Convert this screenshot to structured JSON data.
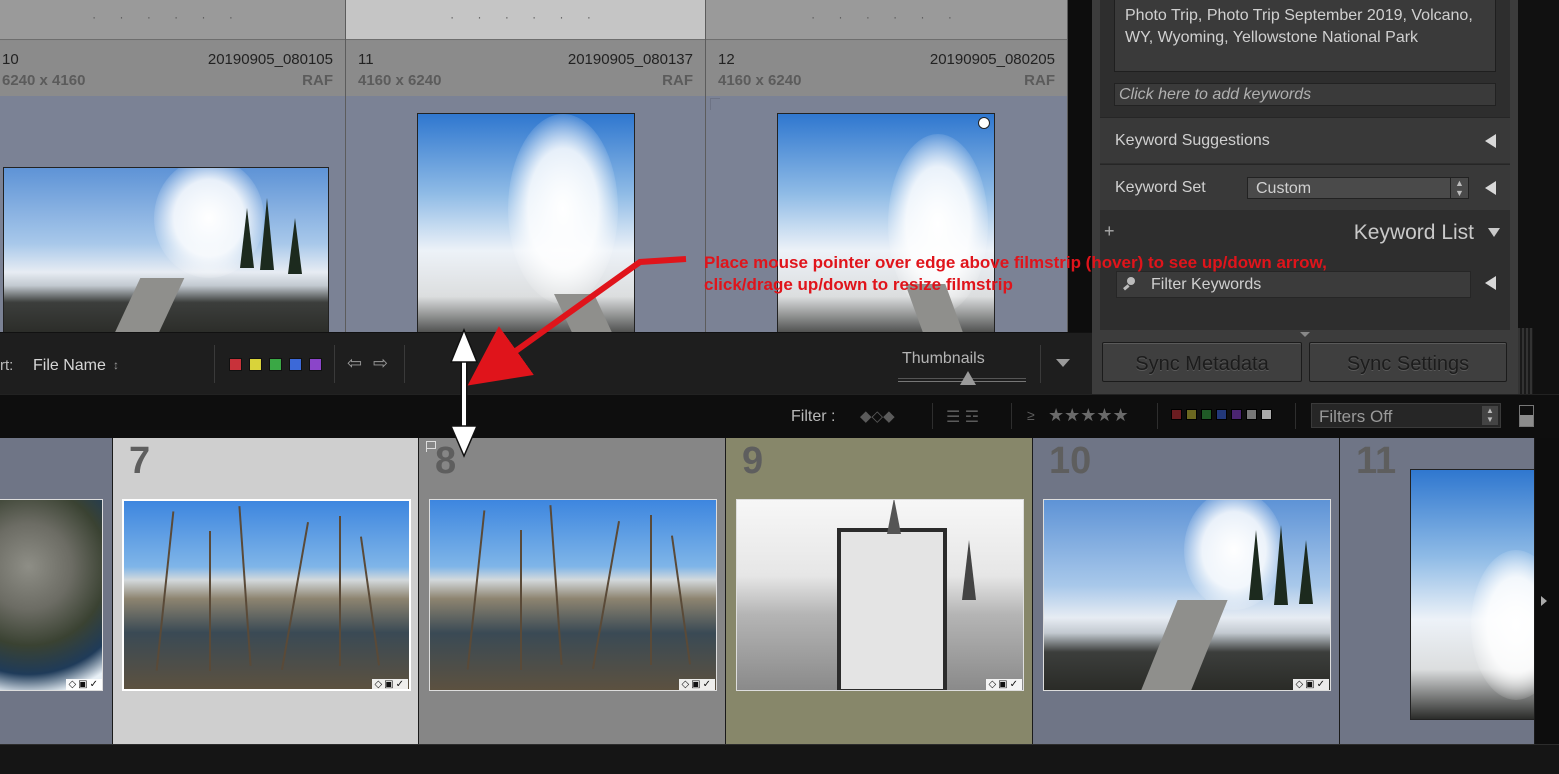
{
  "grid": {
    "cells": [
      {
        "num": "10",
        "filename": "20190905_080105",
        "dims": "6240 x 4160",
        "type": "RAF"
      },
      {
        "num": "11",
        "filename": "20190905_080137",
        "dims": "4160 x 6240",
        "type": "RAF"
      },
      {
        "num": "12",
        "filename": "20190905_080205",
        "dims": "4160 x 6240",
        "type": "RAF"
      }
    ]
  },
  "toolbar": {
    "sort_label": "rt:",
    "sort_value": "File Name",
    "sort_caret": "↕",
    "color_labels": [
      "#c8323a",
      "#d9d33a",
      "#3aa845",
      "#3c69d8",
      "#8b45c9"
    ],
    "prev_icon": "⇦",
    "next_icon": "⇨",
    "thumbnails_label": "Thumbnails",
    "thumbnails_level": 0.55
  },
  "right_panel": {
    "keywords_text": "Photo Trip, Photo Trip September 2019, Volcano, WY, Wyoming, Yellowstone National Park",
    "add_keywords_placeholder": "Click here to add keywords",
    "keyword_suggestions": "Keyword Suggestions",
    "keyword_set_label": "Keyword Set",
    "keyword_set_value": "Custom",
    "keyword_list_plus": "+",
    "keyword_list_title": "Keyword List",
    "filter_keywords": "Filter Keywords",
    "sync_metadata": "Sync Metadata",
    "sync_settings": "Sync Settings"
  },
  "filter_bar": {
    "label": "Filter :",
    "flag_icons": "◆◇◆",
    "edit_icons": "☰ ☲",
    "rating_op": "≥",
    "stars": "★★★★★",
    "color_swatches": [
      "#6a1c20",
      "#6b6720",
      "#1f5a26",
      "#22387a",
      "#4a2470",
      "#777777",
      "#aaaaaa"
    ],
    "preset": "Filters Off"
  },
  "filmstrip": {
    "frames": [
      {
        "num": "7"
      },
      {
        "num": "8"
      },
      {
        "num": "9"
      },
      {
        "num": "10"
      },
      {
        "num": "11"
      }
    ],
    "badge_icons": "◇▣✓"
  },
  "annotation": {
    "text": "Place mouse pointer over edge above filmstrip (hover) to see up/down arrow,\nclick/drage up/down to resize filmstrip",
    "color": "#e0141b"
  },
  "colors": {
    "selected_frame": "#cfcfcf",
    "selected_frame_alt": "#868686",
    "olive_frame": "#87876a",
    "grey_frame": "#6f7586"
  }
}
